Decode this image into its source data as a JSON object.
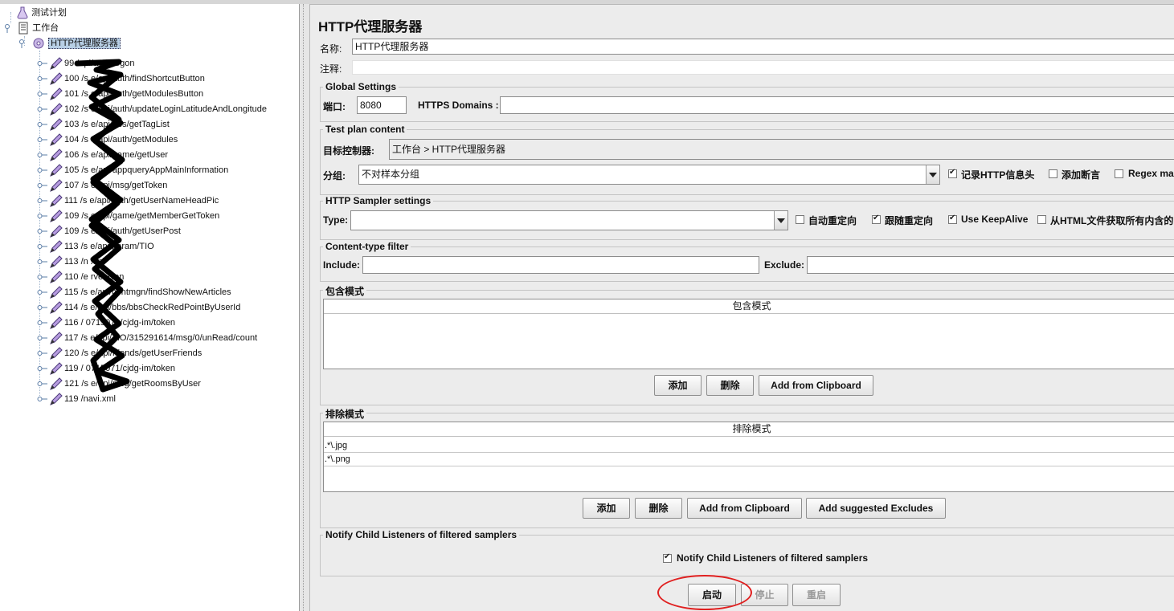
{
  "tree": {
    "test_plan": "测试计划",
    "workbench": "工作台",
    "proxy_server": "HTTP代理服务器",
    "samplers": [
      "99 /api/auth/logon",
      "100 /s         e/api/auth/findShortcutButton",
      "101 /s         e/api/auth/getModulesButton",
      "102 /s         e/api/auth/updateLoginLatitudeAndLongitude",
      "103 /s         e/api/bbs/getTagList",
      "104 /s         e/api/auth/getModules",
      "106 /s         e/api/game/getUser",
      "105 /s         e/api/appqueryAppMainInformation",
      "107 /s         e/api/msg/getToken",
      "111 /s         e/api/auth/getUserNameHeadPic",
      "109 /s         e/api/game/getMemberGetToken",
      "109 /s         e/api/auth/getUserPost",
      "113 /s         e/api/param/TIO",
      "113 /n         xml",
      "110 /e         rver.json",
      "115 /s         e/api/contmgn/findShowNewArticles",
      "114 /s         e/api/bbs/bbsCheckRedPointByUserId",
      "116 /         0715071/cjdg-im/token",
      "117 /s         e/api/TIO/315291614/msg/0/unRead/count",
      "120 /s         e/api/friends/getUserFriends",
      "119 /         0715071/cjdg-im/token",
      "121 /s         e/api/msg/getRoomsByUser",
      "119 /navi.xml"
    ]
  },
  "panel": {
    "title": "HTTP代理服务器",
    "name_label": "名称:",
    "name_value": "HTTP代理服务器",
    "comment_label": "注释:",
    "comment_value": ""
  },
  "global_settings": {
    "title": "Global Settings",
    "port_label": "端口:",
    "port_value": "8080",
    "https_label": "HTTPS Domains :",
    "https_value": ""
  },
  "test_plan_content": {
    "title": "Test plan content",
    "target_label": "目标控制器:",
    "target_value": "工作台 > HTTP代理服务器",
    "group_label": "分组:",
    "group_value": "不对样本分组",
    "record_headers": "记录HTTP信息头",
    "add_assertions": "添加断言",
    "regex_match": "Regex ma"
  },
  "sampler_settings": {
    "title": "HTTP Sampler settings",
    "type_label": "Type:",
    "type_value": "",
    "auto_redirect": "自动重定向",
    "follow_redirect": "跟随重定向",
    "keepalive": "Use KeepAlive",
    "embedded": "从HTML文件获取所有内含的"
  },
  "content_type_filter": {
    "title": "Content-type filter",
    "include_label": "Include:",
    "include_value": "",
    "exclude_label": "Exclude:",
    "exclude_value": ""
  },
  "include_patterns": {
    "title": "包含模式",
    "column": "包含模式",
    "rows": [],
    "add": "添加",
    "delete": "删除",
    "clipboard": "Add from Clipboard"
  },
  "exclude_patterns": {
    "title": "排除模式",
    "column": "排除模式",
    "rows": [
      ".*\\.jpg",
      ".*\\.png"
    ],
    "add": "添加",
    "delete": "删除",
    "clipboard": "Add from Clipboard",
    "suggested": "Add suggested Excludes"
  },
  "notify": {
    "title": "Notify Child Listeners of filtered samplers",
    "checkbox": "Notify Child Listeners of filtered samplers"
  },
  "actions": {
    "start": "启动",
    "stop": "停止",
    "restart": "重启"
  },
  "colors": {
    "annotation_circle": "#e02020",
    "selection": "#b8cfe5"
  }
}
